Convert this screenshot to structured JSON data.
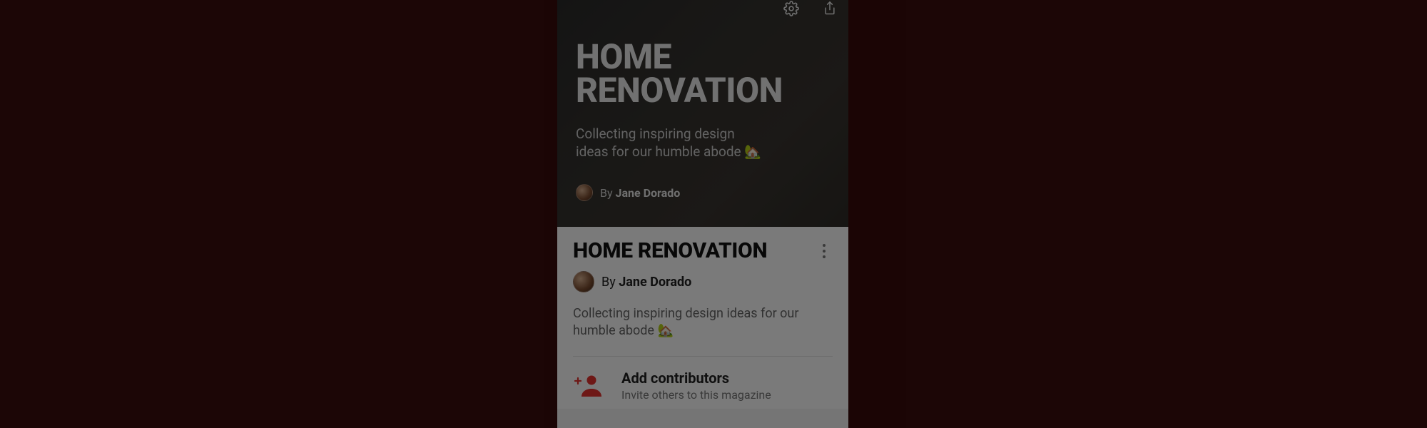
{
  "hero": {
    "title": "HOME RENOVATION",
    "description": "Collecting inspiring design ideas for our humble abode 🏡",
    "by_prefix": "By ",
    "author": "Jane Dorado",
    "icons": {
      "settings": "gear-icon",
      "share": "share-icon"
    }
  },
  "sheet": {
    "title": "HOME RENOVATION",
    "by_prefix": "By ",
    "author": "Jane Dorado",
    "description": "Collecting inspiring design ideas for our humble abode 🏡",
    "contributors": {
      "title": "Add contributors",
      "subtitle": "Invite others to this magazine"
    }
  },
  "colors": {
    "accent": "#e6322f",
    "page_bg": "#3a0c0c"
  }
}
